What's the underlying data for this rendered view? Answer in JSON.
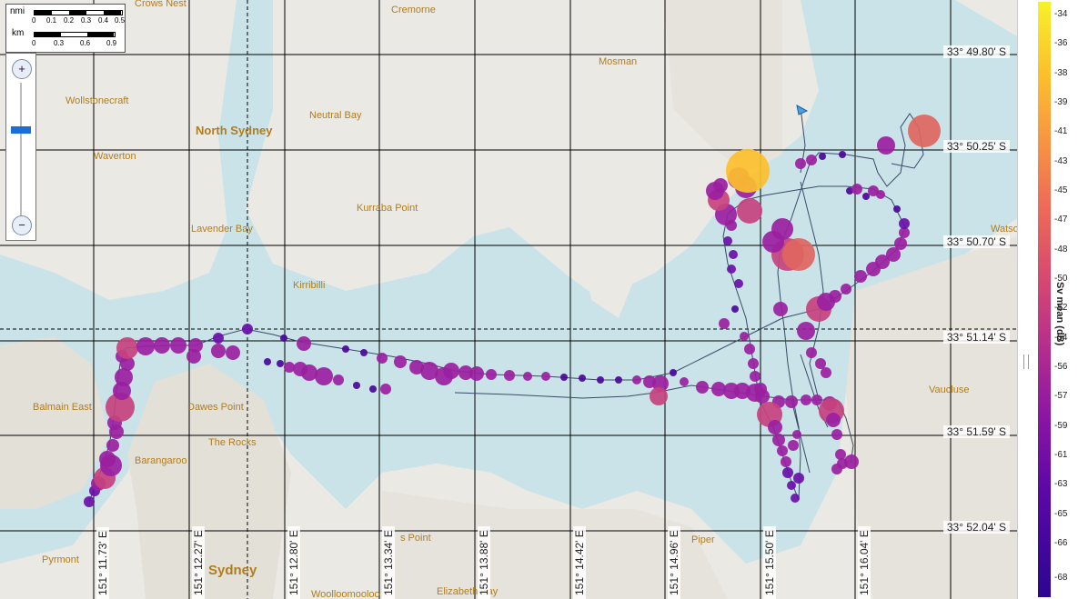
{
  "places": [
    {
      "name": "Crows Nest",
      "cls": ""
    },
    {
      "name": "Cremorne",
      "cls": ""
    },
    {
      "name": "Mosman",
      "cls": ""
    },
    {
      "name": "Wollstonecraft",
      "cls": ""
    },
    {
      "name": "North Sydney",
      "cls": "big"
    },
    {
      "name": "Neutral Bay",
      "cls": ""
    },
    {
      "name": "Waverton",
      "cls": ""
    },
    {
      "name": "Lavender Bay",
      "cls": ""
    },
    {
      "name": "Kurraba Point",
      "cls": ""
    },
    {
      "name": "Kirribilli",
      "cls": ""
    },
    {
      "name": "Balmain East",
      "cls": ""
    },
    {
      "name": "Dawes Point",
      "cls": ""
    },
    {
      "name": "The Rocks",
      "cls": ""
    },
    {
      "name": "Barangaroo",
      "cls": ""
    },
    {
      "name": "Pyrmont",
      "cls": ""
    },
    {
      "name": "Sydney",
      "cls": "huge"
    },
    {
      "name": "Vaucluse",
      "cls": ""
    },
    {
      "name": "Watso",
      "cls": ""
    },
    {
      "name": "Elizabeth Bay",
      "cls": ""
    },
    {
      "name": "Woolloomooloo",
      "cls": ""
    },
    {
      "name": "Piper",
      "cls": ""
    },
    {
      "name": "s Point",
      "cls": ""
    }
  ],
  "lat_labels": [
    "33° 49.80' S",
    "33° 50.25' S",
    "33° 50.70' S",
    "33° 51.14' S",
    "33° 51.59' S",
    "33° 52.04' S"
  ],
  "lon_labels": [
    "151° 11.73' E",
    "151° 12.27' E",
    "151° 12.80' E",
    "151° 13.34' E",
    "151° 13.88' E",
    "151° 14.42' E",
    "151° 14.96' E",
    "151° 15.50' E",
    "151° 16.04' E"
  ],
  "scalebar": {
    "nmi_label": "nmi",
    "nmi_ticks": [
      "0",
      "0.1",
      "0.2",
      "0.3",
      "0.4",
      "0.5"
    ],
    "km_label": "km",
    "km_ticks": [
      "0",
      "0.3",
      "0.6",
      "0.9"
    ]
  },
  "zoom": {
    "in_icon": "zoom-in-icon",
    "out_icon": "zoom-out-icon"
  },
  "legend": {
    "title": "Sv mean (dB)",
    "levels": [
      "-34",
      "-36",
      "-38",
      "-39",
      "-41",
      "-43",
      "-45",
      "-47",
      "-48",
      "-50",
      "-52",
      "-54",
      "-56",
      "-57",
      "-59",
      "-61",
      "-63",
      "-65",
      "-66",
      "-68"
    ]
  },
  "colors": {
    "water": "#c9e3e8",
    "land": "#ececec",
    "track": "#3a4a68",
    "grid": "#000000"
  }
}
